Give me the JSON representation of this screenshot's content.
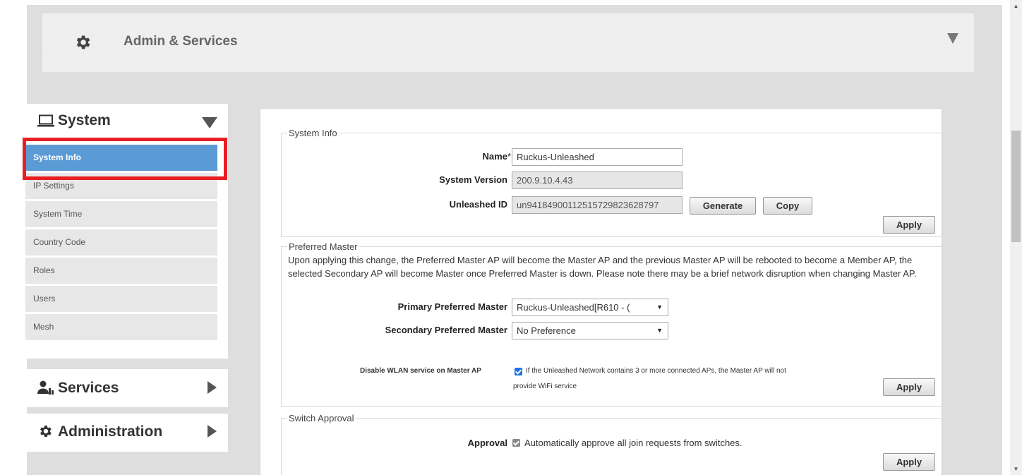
{
  "header": {
    "title": "Admin & Services"
  },
  "sidebar": {
    "system_label": "System",
    "system_items": [
      {
        "label": "System Info",
        "active": true
      },
      {
        "label": "IP Settings"
      },
      {
        "label": "System Time"
      },
      {
        "label": "Country Code"
      },
      {
        "label": "Roles"
      },
      {
        "label": "Users"
      },
      {
        "label": "Mesh"
      }
    ],
    "services_label": "Services",
    "administration_label": "Administration"
  },
  "system_info": {
    "legend": "System Info",
    "name_label": "Name",
    "name_required": "*",
    "name_value": "Ruckus-Unleashed",
    "version_label": "System Version",
    "version_value": "200.9.10.4.43",
    "unleashed_id_label": "Unleashed ID",
    "unleashed_id_value": "un94184900112515729823628797",
    "generate_label": "Generate",
    "copy_label": "Copy",
    "apply_label": "Apply"
  },
  "preferred_master": {
    "legend": "Preferred Master",
    "description": "Upon applying this change, the Preferred Master AP will become the Master AP and the previous Master AP will be rebooted to become a Member AP, the selected Secondary AP will become Master once Preferred Master is down. Please note there may be a brief network disruption when changing Master AP.",
    "primary_label": "Primary Preferred Master",
    "primary_value": "Ruckus-Unleashed[R610 - (",
    "secondary_label": "Secondary Preferred Master",
    "secondary_value": "No Preference",
    "disable_wlan_label": "Disable WLAN service on Master AP",
    "disable_wlan_text": "If the Unleashed Network contains 3 or more connected APs, the Master AP will not",
    "disable_wlan_text_2": "provide WiFi service",
    "apply_label": "Apply"
  },
  "switch_approval": {
    "legend": "Switch Approval",
    "approval_label": "Approval",
    "approval_text": "Automatically approve all join requests from switches.",
    "apply_label": "Apply"
  }
}
